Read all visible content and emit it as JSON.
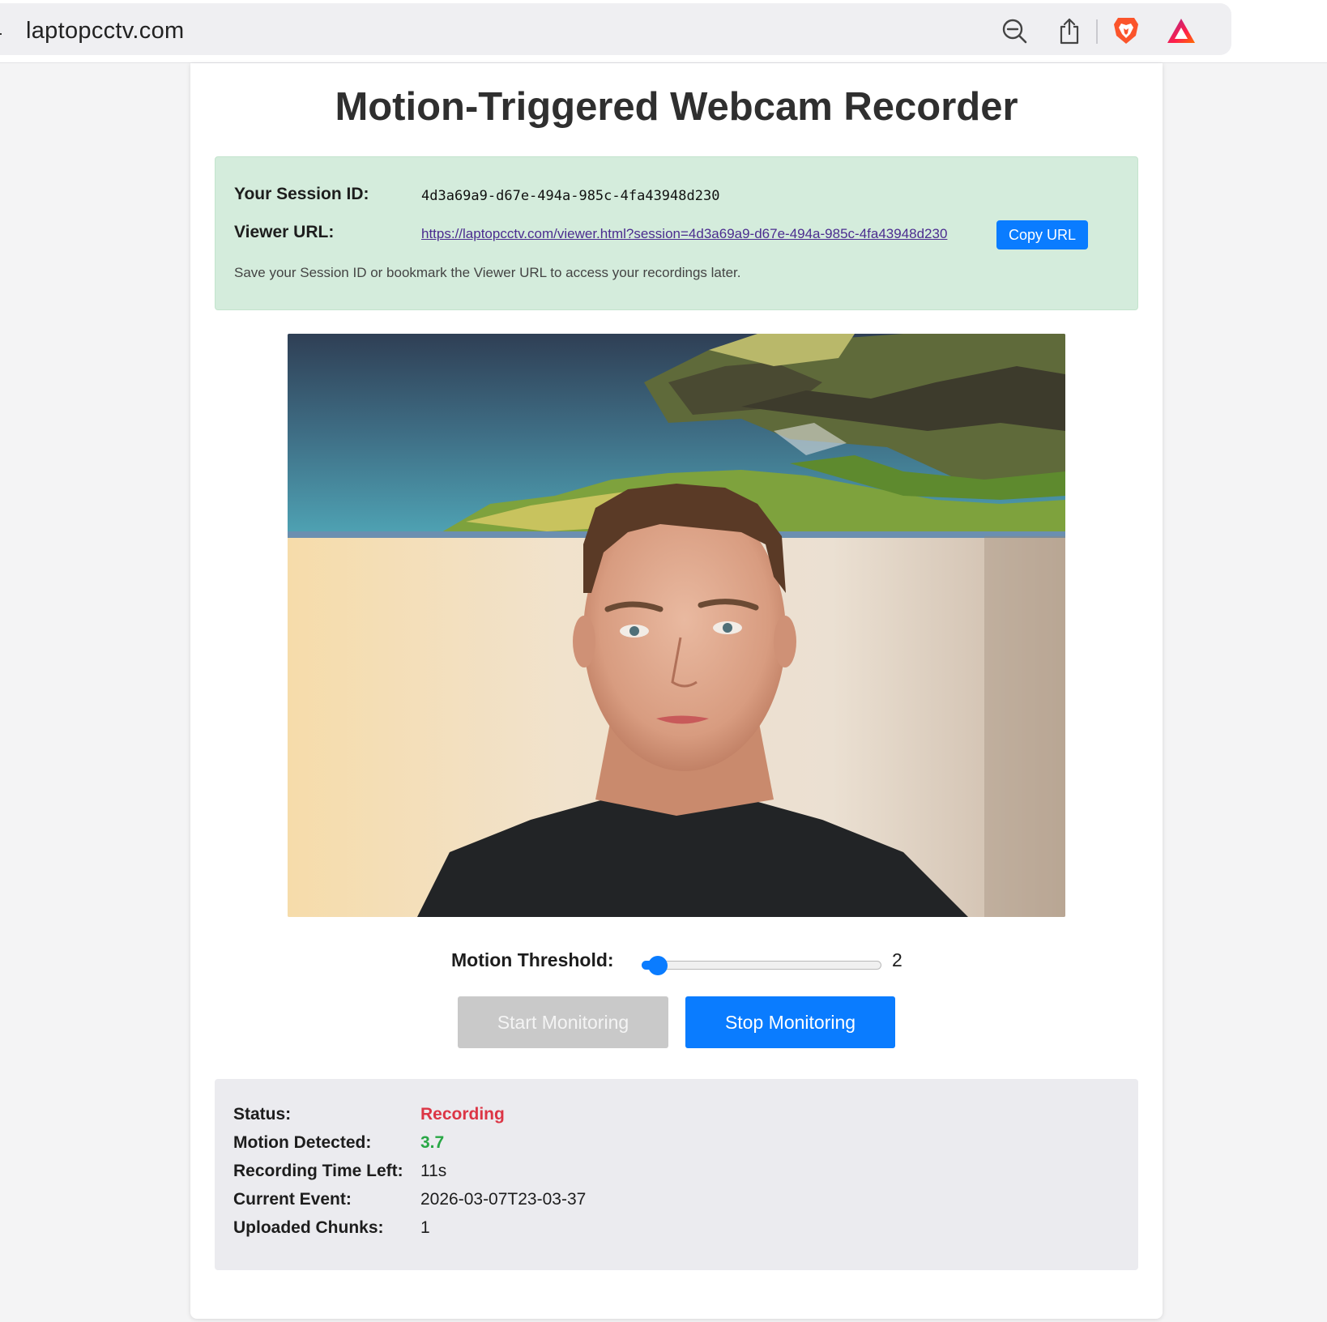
{
  "browser": {
    "domain": "laptopcctv.com",
    "icons": {
      "site_settings": "site-settings-icon",
      "zoom_out": "zoom-out-icon",
      "share": "share-icon",
      "brave": "brave-lion-icon",
      "rewards": "brave-rewards-icon"
    },
    "colors": {
      "brave": "#fb542b",
      "rewards_a": "#a3278f",
      "rewards_b": "#ff6d00"
    }
  },
  "page": {
    "title": "Motion-Triggered Webcam Recorder",
    "session": {
      "session_id_label": "Your Session ID:",
      "session_id": "4d3a69a9-d67e-494a-985c-4fa43948d230",
      "viewer_url_label": "Viewer URL:",
      "viewer_url": "https://laptopcctv.com/viewer.html?session=4d3a69a9-d67e-494a-985c-4fa43948d230",
      "copy_button": "Copy URL",
      "note": "Save your Session ID or bookmark the Viewer URL to access your recordings later."
    },
    "controls": {
      "threshold_label": "Motion Threshold:",
      "threshold_value": "2",
      "threshold_fraction": 0.03,
      "start_button": "Start Monitoring",
      "start_disabled": true,
      "stop_button": "Stop Monitoring"
    },
    "status": [
      {
        "label": "Status:",
        "value": "Recording",
        "color": "#dc3545",
        "bold": true
      },
      {
        "label": "Motion Detected:",
        "value": "3.7",
        "color": "#28a745",
        "bold": true
      },
      {
        "label": "Recording Time Left:",
        "value": "11s",
        "color": "#1d1d1d",
        "bold": false
      },
      {
        "label": "Current Event:",
        "value": "2026-03-07T23-03-37",
        "color": "#1d1d1d",
        "bold": false
      },
      {
        "label": "Uploaded Chunks:",
        "value": "1",
        "color": "#1d1d1d",
        "bold": false
      }
    ]
  },
  "colors": {
    "accent": "#0a7cff",
    "session_bg": "#d4ecdc",
    "status_bg": "#ebebef",
    "link": "#4b2c8f"
  }
}
